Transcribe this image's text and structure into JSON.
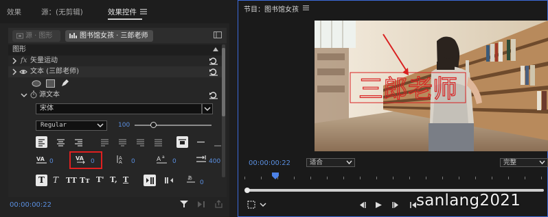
{
  "effect_controls": {
    "tabs": [
      {
        "label": "效果"
      },
      {
        "label": "源：(无剪辑)"
      },
      {
        "label": "效果控件"
      }
    ],
    "tab_menu_icon": "hamburger-icon",
    "source_pill": "源 · 图形",
    "sequence_pill": "图书馆女孩 · 三郎老师",
    "graphic_header": "图形",
    "vector_motion_fx": "fx",
    "vector_motion": "矢量运动",
    "text_layer": "文本 (三郎老师)",
    "source_text": "源文本",
    "font_value": "宋体",
    "font_style": "Regular",
    "font_size": "100",
    "kerning_value": "0",
    "tracking_value": "0",
    "leading_value": "0",
    "baseline_value": "0",
    "tab_width_value": "400",
    "format_buttons": [
      "T",
      "T",
      "TT",
      "Tт",
      "T'",
      "T,",
      "T"
    ],
    "timecode": "00:00:00:22"
  },
  "program_monitor": {
    "title": "节目：图书馆女孩",
    "menu_icon": "hamburger-icon",
    "overlay_text": "三郎老师",
    "timecode": "00:00:00:22",
    "fit_dropdown": "适合",
    "quality_dropdown": "完整"
  },
  "watermark": "sanlang2021",
  "colors": {
    "accent_blue": "#3c6bdc",
    "timecode_blue": "#5a8fe0",
    "highlight_red": "#e02020",
    "text_red": "#d92020"
  }
}
